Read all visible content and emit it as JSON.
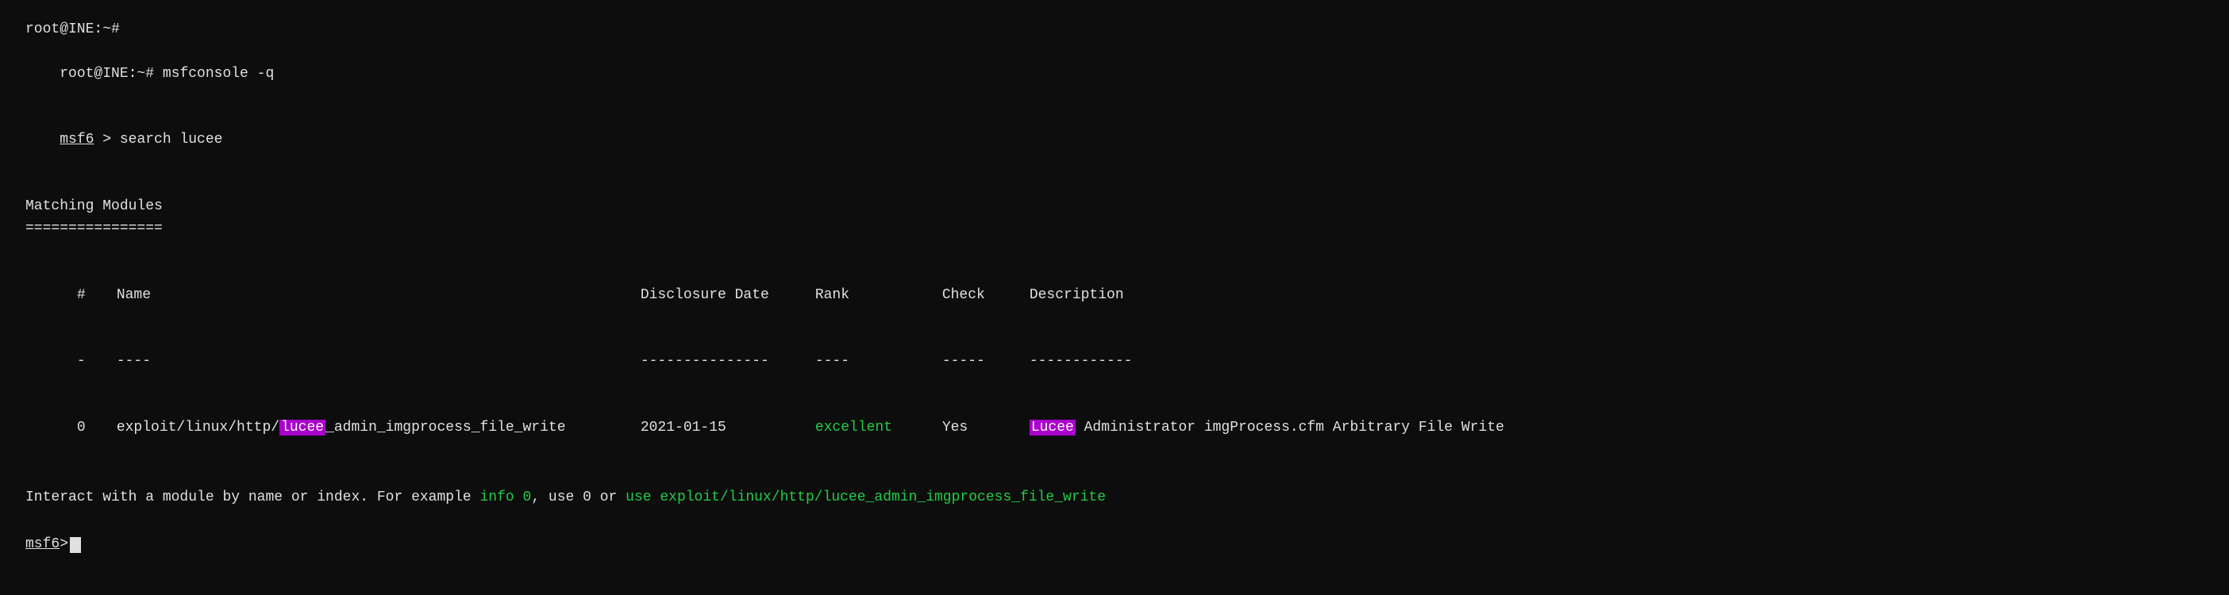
{
  "terminal": {
    "lines": {
      "line1": "root@INE:~#",
      "line2_prefix": "root@INE:~# ",
      "line2_cmd": "msfconsole -q",
      "line3_prefix": "msf6 > ",
      "line3_cmd": "search lucee",
      "line3_underline": "msf6"
    },
    "section_title": "Matching Modules",
    "separator": "================",
    "table": {
      "headers": {
        "num": "#",
        "name": "Name",
        "date": "Disclosure Date",
        "rank": "Rank",
        "check": "Check",
        "desc": "Description"
      },
      "dividers": {
        "num": "-",
        "name": "----",
        "date": "---------------",
        "rank": "----",
        "check": "-----",
        "desc": "------------"
      },
      "rows": [
        {
          "num": "0",
          "name_pre": "exploit/linux/http/",
          "name_highlight": "lucee",
          "name_post": "_admin_imgprocess_file_write",
          "date": "2021-01-15",
          "rank": "excellent",
          "check": "Yes",
          "desc_pre": "",
          "desc_highlight": "Lucee",
          "desc_post": " Administrator imgProcess.cfm Arbitrary File Write"
        }
      ]
    },
    "interact_text_1": "Interact with a module by name or index. For example ",
    "interact_cmd1": "info 0",
    "interact_text_2": ", use 0 or ",
    "interact_cmd2": "use exploit/linux/http/lucee_admin_imgprocess_file_write",
    "prompt_final": "msf6 > ",
    "prompt_final_underline": "msf6"
  }
}
